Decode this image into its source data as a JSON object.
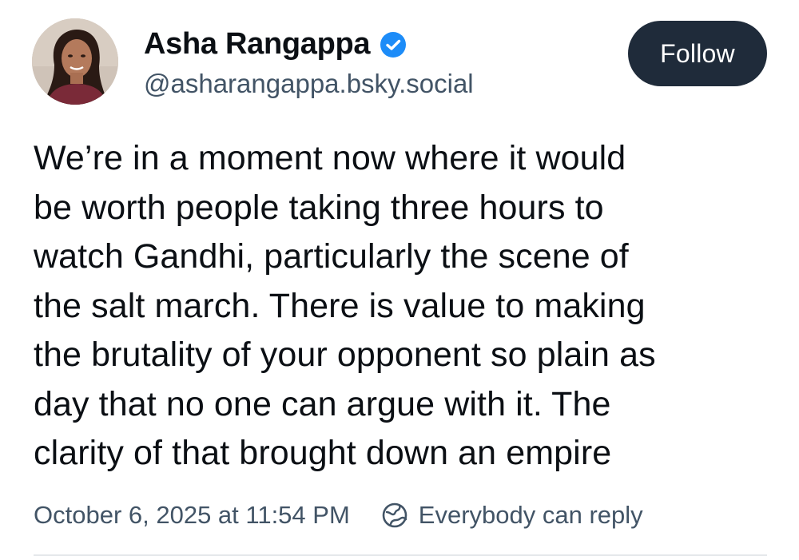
{
  "author": {
    "display_name": "Asha Rangappa",
    "handle": "@asharangappa.bsky.social",
    "verified_icon": "verified-badge-icon",
    "verified_color": "#1d8cf8"
  },
  "follow_button": {
    "label": "Follow",
    "background": "#1f2b3a"
  },
  "post": {
    "text": "We’re in a moment now where it would\nbe worth people taking three hours to\nwatch Gandhi, particularly the scene of\nthe salt march. There is value to making\nthe brutality of your opponent so plain as\nday that no one can argue with it. The\nclarity of that brought down an empire"
  },
  "meta": {
    "timestamp": "October 6, 2025 at 11:54 PM",
    "reply_setting": "Everybody can reply",
    "reply_icon": "globe-reply-icon"
  }
}
